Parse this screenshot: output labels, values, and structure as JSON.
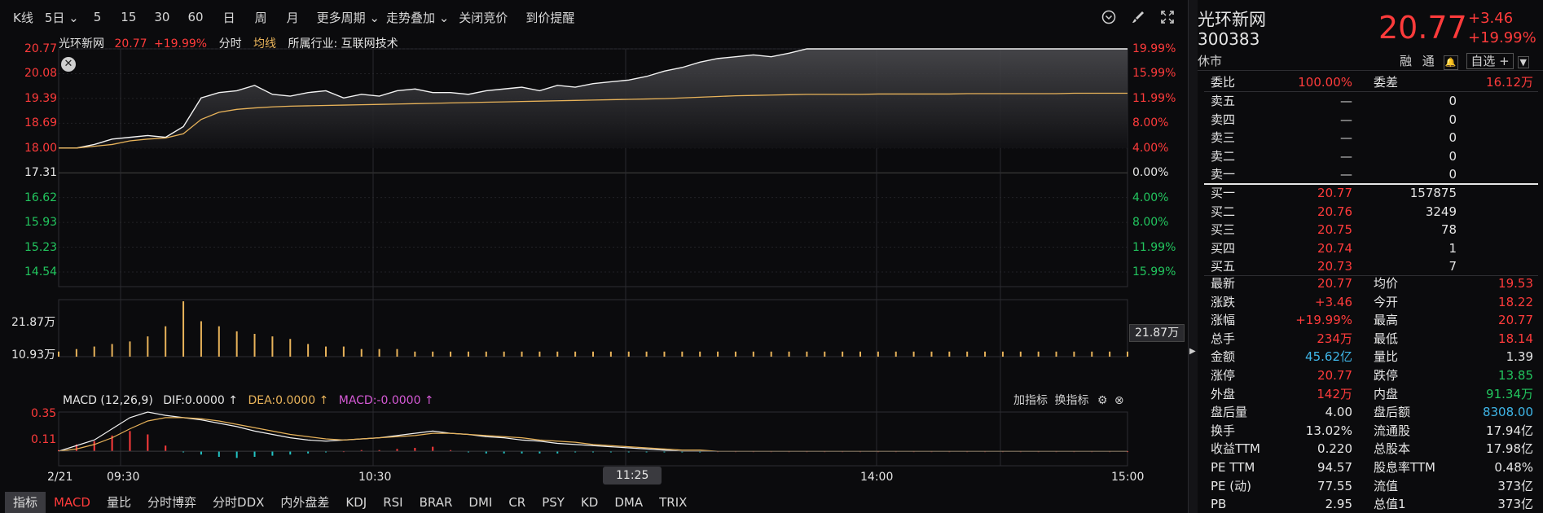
{
  "toolbar": {
    "items": [
      "K线",
      "5日 ⌄",
      "5",
      "15",
      "30",
      "60",
      "日",
      "周",
      "月",
      "更多周期 ⌄",
      "走势叠加 ⌄",
      "关闭竞价",
      "到价提醒"
    ],
    "tools": [
      "circle-chevron-icon",
      "brush-icon",
      "expand-icon"
    ]
  },
  "info_bar": {
    "name": "光环新网",
    "price": "20.77",
    "pct": "+19.99%",
    "mode": "分时",
    "avg_label": "均线",
    "industry": "所属行业: 互联网技术"
  },
  "price_axis": {
    "left": [
      "20.77",
      "20.08",
      "19.39",
      "18.69",
      "18.00",
      "17.31",
      "16.62",
      "15.93",
      "15.23",
      "14.54"
    ],
    "right": [
      "19.99%",
      "15.99%",
      "11.99%",
      "8.00%",
      "4.00%",
      "0.00%",
      "4.00%",
      "8.00%",
      "11.99%",
      "15.99%"
    ]
  },
  "volume_axis": {
    "left": [
      "21.87万",
      "10.93万"
    ],
    "right_tag": "21.87万"
  },
  "macd_bar": {
    "title": "MACD (12,26,9)",
    "dif": "DIF:0.0000 ↑",
    "dea": "DEA:0.0000 ↑",
    "macd": "MACD:-0.0000 ↑",
    "add_indicator": "加指标",
    "switch_indicator": "换指标",
    "axis": [
      "0.35",
      "0.11"
    ]
  },
  "time_axis": {
    "date": "2/21",
    "labels": [
      "09:30",
      "10:30",
      "14:00",
      "15:00"
    ],
    "cursor": "11:25"
  },
  "tabs": [
    "指标",
    "MACD",
    "量比",
    "分时博弈",
    "分时DDX",
    "内外盘差",
    "KDJ",
    "RSI",
    "BRAR",
    "DMI",
    "CR",
    "PSY",
    "KD",
    "DMA",
    "TRIX"
  ],
  "panel": {
    "name": "光环新网",
    "code": "300383",
    "status": "休市",
    "price": "20.77",
    "change": "+3.46",
    "pct": "+19.99%",
    "rong": "融",
    "tong": "通",
    "watch": "自选 +",
    "weibi_label": "委比",
    "weibi": "100.00%",
    "weicha_label": "委差",
    "weicha": "16.12万",
    "asks": [
      {
        "label": "卖五",
        "price": "—",
        "vol": "0"
      },
      {
        "label": "卖四",
        "price": "—",
        "vol": "0"
      },
      {
        "label": "卖三",
        "price": "—",
        "vol": "0"
      },
      {
        "label": "卖二",
        "price": "—",
        "vol": "0"
      },
      {
        "label": "卖一",
        "price": "—",
        "vol": "0"
      }
    ],
    "bids": [
      {
        "label": "买一",
        "price": "20.77",
        "vol": "157875"
      },
      {
        "label": "买二",
        "price": "20.76",
        "vol": "3249"
      },
      {
        "label": "买三",
        "price": "20.75",
        "vol": "78"
      },
      {
        "label": "买四",
        "price": "20.74",
        "vol": "1"
      },
      {
        "label": "买五",
        "price": "20.73",
        "vol": "7"
      }
    ],
    "stats": [
      {
        "l1": "最新",
        "v1": "20.77",
        "c1": "red",
        "l2": "均价",
        "v2": "19.53",
        "c2": "red"
      },
      {
        "l1": "涨跌",
        "v1": "+3.46",
        "c1": "red",
        "l2": "今开",
        "v2": "18.22",
        "c2": "red"
      },
      {
        "l1": "涨幅",
        "v1": "+19.99%",
        "c1": "red",
        "l2": "最高",
        "v2": "20.77",
        "c2": "red"
      },
      {
        "l1": "总手",
        "v1": "234万",
        "c1": "red",
        "l2": "最低",
        "v2": "18.14",
        "c2": "red"
      },
      {
        "l1": "金额",
        "v1": "45.62亿",
        "c1": "cyan",
        "l2": "量比",
        "v2": "1.39",
        "c2": "white"
      },
      {
        "l1": "涨停",
        "v1": "20.77",
        "c1": "red",
        "l2": "跌停",
        "v2": "13.85",
        "c2": "green"
      },
      {
        "l1": "外盘",
        "v1": "142万",
        "c1": "red",
        "l2": "内盘",
        "v2": "91.34万",
        "c2": "green"
      },
      {
        "l1": "盘后量",
        "v1": "4.00",
        "c1": "white",
        "l2": "盘后额",
        "v2": "8308.00",
        "c2": "cyan"
      },
      {
        "l1": "换手",
        "v1": "13.02%",
        "c1": "white",
        "l2": "流通股",
        "v2": "17.94亿",
        "c2": "white"
      },
      {
        "l1": "收益TTM",
        "v1": "0.220",
        "c1": "white",
        "l2": "总股本",
        "v2": "17.98亿",
        "c2": "white"
      },
      {
        "l1": "PE TTM",
        "v1": "94.57",
        "c1": "white",
        "l2": "股息率TTM",
        "v2": "0.48%",
        "c2": "white"
      },
      {
        "l1": "PE (动)",
        "v1": "77.55",
        "c1": "white",
        "l2": "流值",
        "v2": "373亿",
        "c2": "white"
      },
      {
        "l1": "PB",
        "v1": "2.95",
        "c1": "white",
        "l2": "总值1",
        "v2": "373亿",
        "c2": "white"
      }
    ]
  },
  "chart_data": {
    "type": "line",
    "ylim": [
      14.54,
      20.77
    ],
    "series": [
      {
        "values": [
          18.0,
          18.0,
          18.1,
          18.25,
          18.3,
          18.35,
          18.3,
          18.6,
          19.4,
          19.55,
          19.6,
          19.75,
          19.5,
          19.45,
          19.55,
          19.6,
          19.4,
          19.5,
          19.45,
          19.6,
          19.65,
          19.55,
          19.55,
          19.5,
          19.6,
          19.65,
          19.7,
          19.6,
          19.75,
          19.7,
          19.8,
          19.85,
          19.9,
          20.0,
          20.15,
          20.25,
          20.4,
          20.5,
          20.55,
          20.6,
          20.55,
          20.65,
          20.77,
          20.77,
          20.77,
          20.77,
          20.77,
          20.77,
          20.77,
          20.77,
          20.77,
          20.77,
          20.77,
          20.77,
          20.77,
          20.77,
          20.77,
          20.77,
          20.77,
          20.77,
          20.77
        ]
      },
      {
        "values": [
          18.0,
          18.0,
          18.05,
          18.1,
          18.2,
          18.25,
          18.28,
          18.4,
          18.8,
          19.0,
          19.08,
          19.12,
          19.15,
          19.17,
          19.18,
          19.19,
          19.2,
          19.21,
          19.22,
          19.23,
          19.24,
          19.25,
          19.26,
          19.27,
          19.28,
          19.29,
          19.3,
          19.31,
          19.32,
          19.33,
          19.34,
          19.35,
          19.36,
          19.37,
          19.38,
          19.4,
          19.42,
          19.44,
          19.46,
          19.47,
          19.48,
          19.49,
          19.5,
          19.5,
          19.5,
          19.5,
          19.51,
          19.51,
          19.51,
          19.51,
          19.51,
          19.52,
          19.52,
          19.52,
          19.52,
          19.52,
          19.52,
          19.53,
          19.53,
          19.53,
          19.53
        ]
      }
    ],
    "volume": [
      2,
      3,
      4,
      5,
      6,
      8,
      12,
      21.87,
      14,
      12,
      10,
      9,
      8,
      7,
      5,
      4,
      4,
      3,
      3,
      3,
      2,
      2,
      2,
      2,
      2,
      2,
      2,
      2,
      2,
      2,
      2,
      2,
      2,
      2,
      2,
      2,
      2,
      2,
      2,
      2,
      2,
      2,
      2,
      2,
      2,
      2,
      2,
      2,
      2,
      2,
      2,
      2,
      2,
      2,
      2,
      2,
      2,
      2,
      2,
      2,
      2
    ],
    "macd_dif": [
      0.0,
      0.05,
      0.1,
      0.2,
      0.3,
      0.35,
      0.32,
      0.3,
      0.28,
      0.25,
      0.22,
      0.18,
      0.15,
      0.12,
      0.1,
      0.09,
      0.1,
      0.11,
      0.12,
      0.14,
      0.16,
      0.18,
      0.16,
      0.15,
      0.13,
      0.12,
      0.1,
      0.09,
      0.07,
      0.06,
      0.05,
      0.04,
      0.03,
      0.02,
      0.01,
      0.0,
      0.0,
      0.0,
      0.0,
      0.0,
      0.0,
      0.0,
      0.0,
      0.0,
      0.0,
      0.0,
      0.0,
      0.0,
      0.0,
      0.0,
      0.0,
      0.0,
      0.0,
      0.0,
      0.0,
      0.0,
      0.0,
      0.0,
      0.0,
      0.0,
      0.0
    ],
    "macd_dea": [
      0.0,
      0.02,
      0.06,
      0.12,
      0.2,
      0.27,
      0.3,
      0.3,
      0.29,
      0.27,
      0.24,
      0.21,
      0.18,
      0.15,
      0.13,
      0.11,
      0.1,
      0.11,
      0.12,
      0.13,
      0.14,
      0.16,
      0.16,
      0.15,
      0.14,
      0.13,
      0.12,
      0.1,
      0.09,
      0.08,
      0.06,
      0.05,
      0.04,
      0.03,
      0.02,
      0.01,
      0.01,
      0.0,
      0.0,
      0.0,
      0.0,
      0.0,
      0.0,
      0.0,
      0.0,
      0.0,
      0.0,
      0.0,
      0.0,
      0.0,
      0.0,
      0.0,
      0.0,
      0.0,
      0.0,
      0.0,
      0.0,
      0.0,
      0.0,
      0.0,
      0.0
    ],
    "macd_hist": [
      0.01,
      0.06,
      0.09,
      0.14,
      0.18,
      0.15,
      0.05,
      -0.01,
      -0.03,
      -0.05,
      -0.06,
      -0.05,
      -0.04,
      -0.03,
      -0.02,
      -0.01,
      0.0,
      0.01,
      0.01,
      0.02,
      0.03,
      0.04,
      0.01,
      -0.01,
      -0.02,
      -0.02,
      -0.02,
      -0.02,
      -0.02,
      -0.01,
      -0.01,
      -0.01,
      -0.01,
      -0.01,
      -0.01,
      -0.01,
      -0.01,
      0.0,
      0.0,
      0.0,
      0.0,
      0.0,
      0.0,
      0.0,
      0.0,
      0.0,
      0.0,
      0.0,
      0.0,
      0.0,
      0.0,
      0.0,
      0.0,
      0.0,
      0.0,
      0.0,
      0.0,
      0.0,
      0.0,
      0.0,
      0.0
    ],
    "macd_ylim": [
      -0.13,
      0.35
    ],
    "vol_max": 21.87,
    "colors": {
      "price": "#f2f2f2",
      "avg": "#e8b35a",
      "up": "#ff3b3b",
      "down": "#22c5c5",
      "dif": "#f2f2f2",
      "dea": "#e8b35a"
    }
  }
}
